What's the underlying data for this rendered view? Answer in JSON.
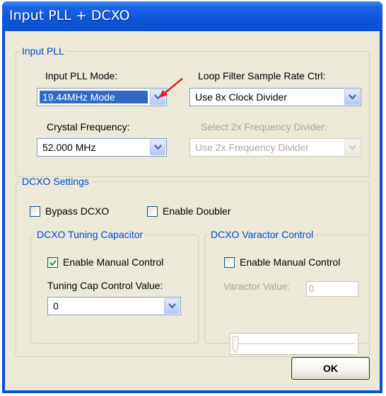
{
  "window": {
    "title": "Input PLL + DCXO"
  },
  "input_pll": {
    "legend": "Input PLL",
    "mode_label": "Input PLL Mode:",
    "mode_value": "19.44MHz Mode",
    "loop_filter_label": "Loop Filter Sample Rate Ctrl:",
    "loop_filter_value": "Use 8x Clock Divider",
    "crystal_label": "Crystal Frequency:",
    "crystal_value": "52.000 MHz",
    "freq_divider_label": "Select 2x Frequency Divider:",
    "freq_divider_value": "Use 2x Frequency Divider"
  },
  "dcxo": {
    "legend": "DCXO Settings",
    "bypass_label": "Bypass DCXO",
    "bypass_checked": false,
    "doubler_label": "Enable Doubler",
    "doubler_checked": false,
    "tuning": {
      "legend": "DCXO Tuning Capacitor",
      "manual_label": "Enable Manual Control",
      "manual_checked": true,
      "cap_label": "Tuning Cap Control Value:",
      "cap_value": "0"
    },
    "varactor": {
      "legend": "DCXO Varactor Control",
      "manual_label": "Enable Manual Control",
      "manual_checked": false,
      "value_label": "Varactor Value:",
      "value": "0",
      "slider_level": 0
    }
  },
  "buttons": {
    "ok_label": "OK"
  },
  "colors": {
    "title_bar": "#0a4fd6",
    "group_legend": "#0046d5",
    "annotation_arrow": "#e8171f"
  }
}
